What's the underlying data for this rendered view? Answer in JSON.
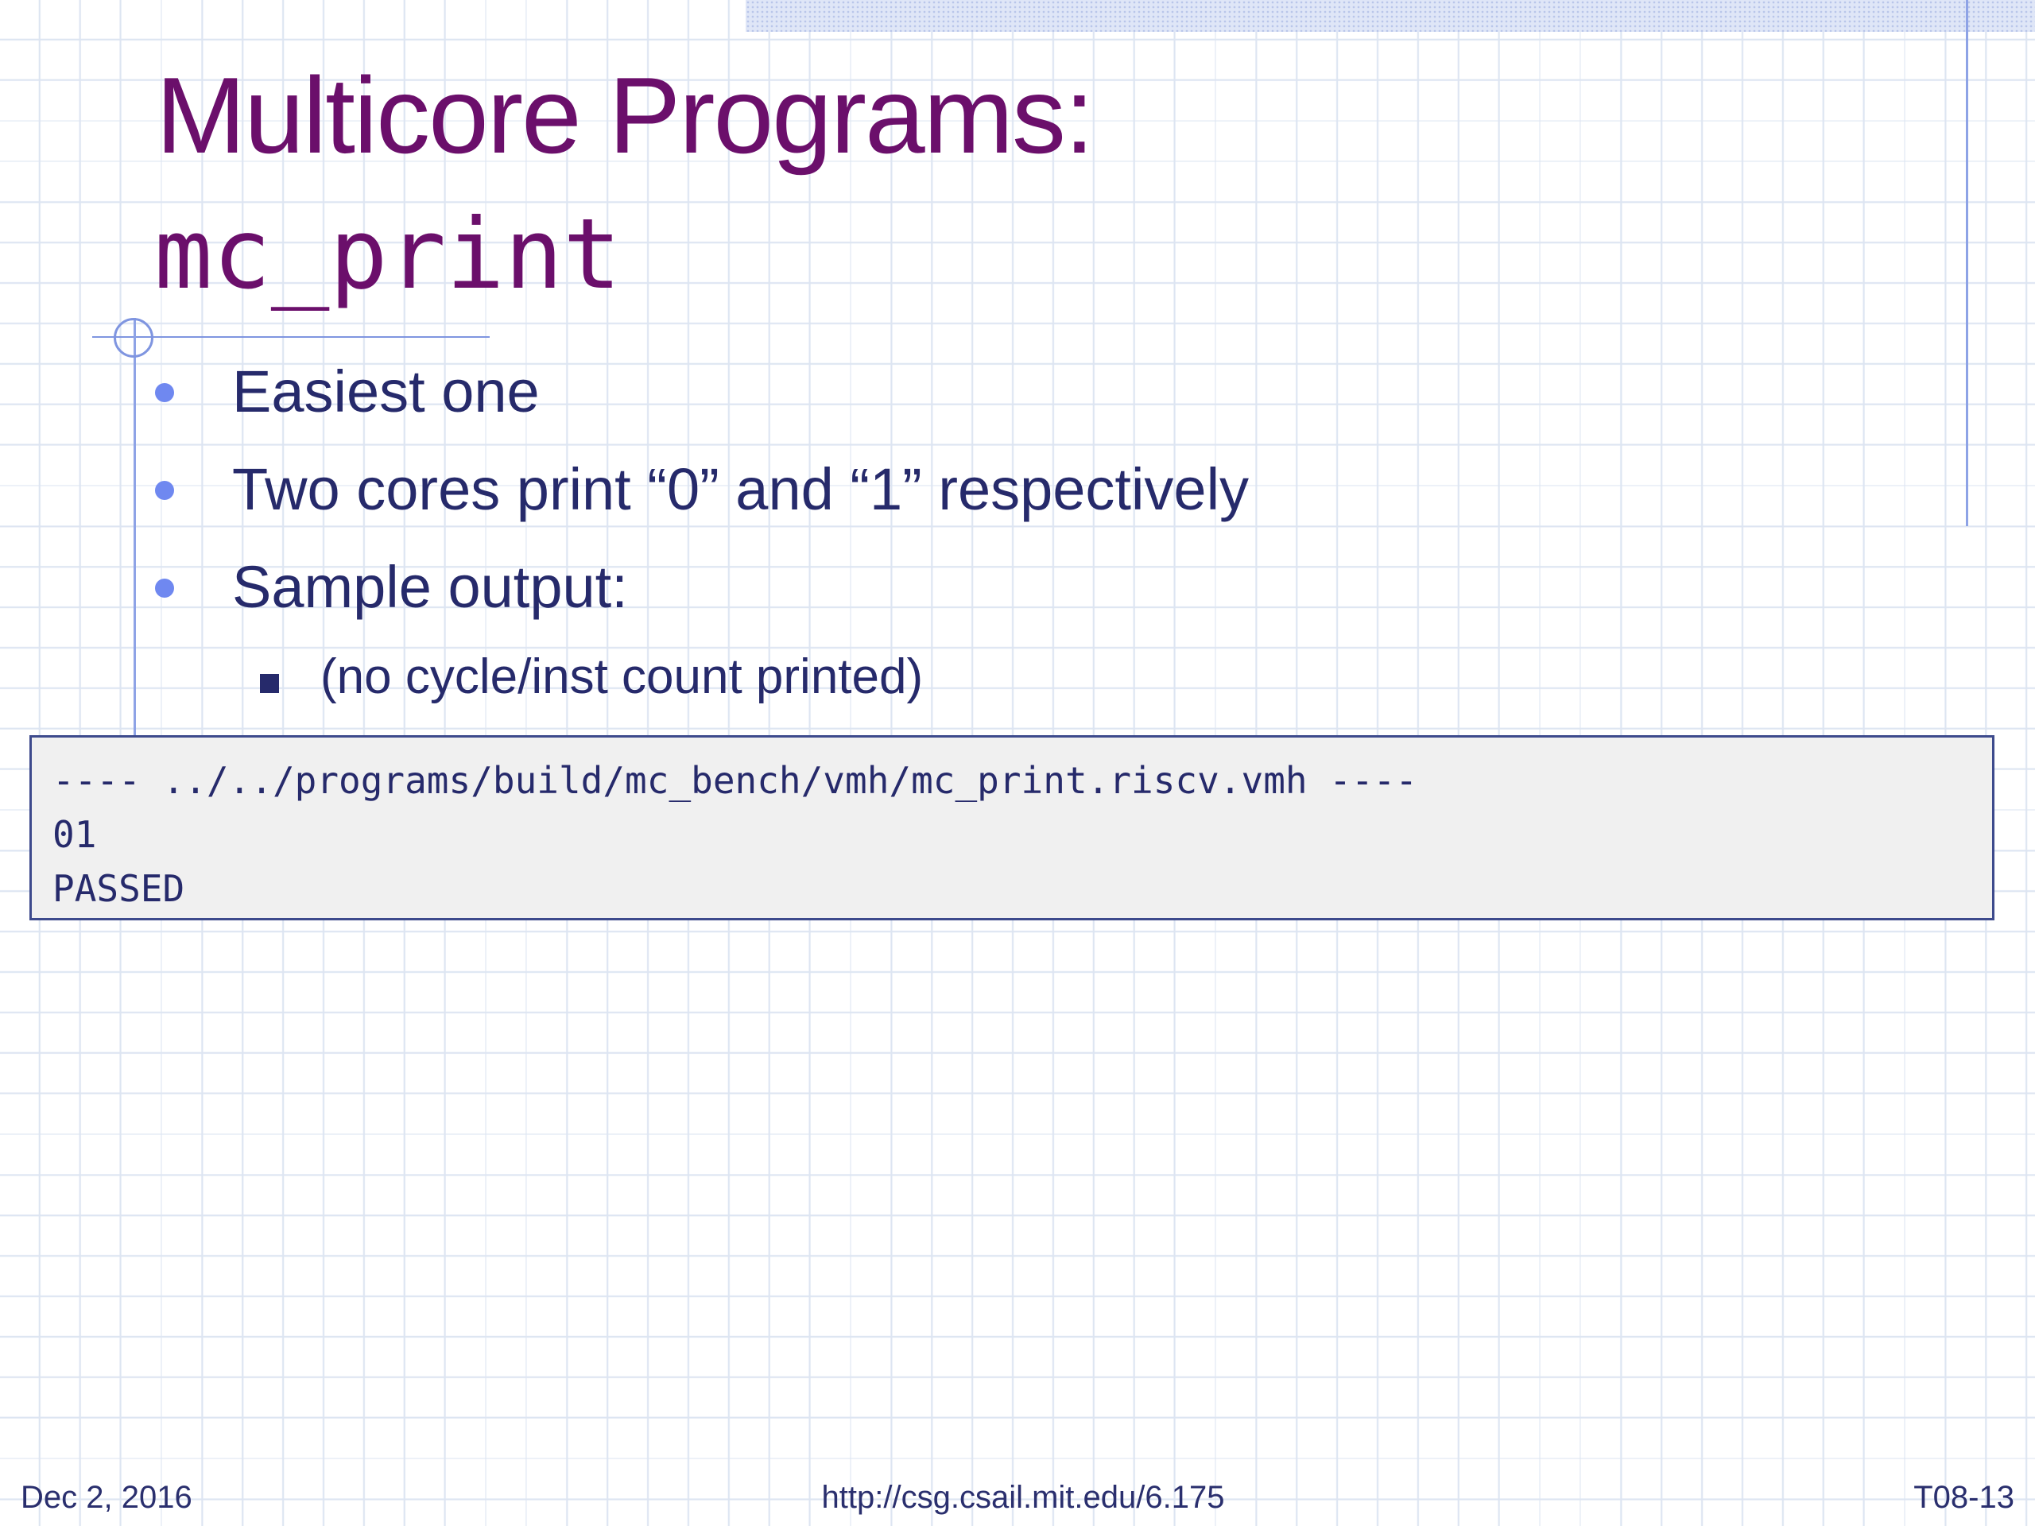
{
  "slide": {
    "title": "Multicore Programs:",
    "subtitle": "mc_print",
    "bullets": [
      "Easiest one",
      "Two cores print “0” and “1” respectively",
      "Sample output:"
    ],
    "sub_bullets": [
      "(no cycle/inst count printed)"
    ],
    "code_output": {
      "lines": [
        "---- ../../programs/build/mc_bench/vmh/mc_print.riscv.vmh ----",
        "01",
        "PASSED"
      ]
    },
    "footer": {
      "date": "Dec 2, 2016",
      "url": "http://csg.csail.mit.edu/6.175",
      "slide_number": "T08-13"
    }
  },
  "colors": {
    "title": "#6b0f6b",
    "body_text": "#262a6b",
    "bullet": "#6f88f0",
    "rule": "#8ea3e6",
    "code_background": "#f0f0f0",
    "code_border": "#3d4a8c",
    "grid": "#dde5f2"
  }
}
